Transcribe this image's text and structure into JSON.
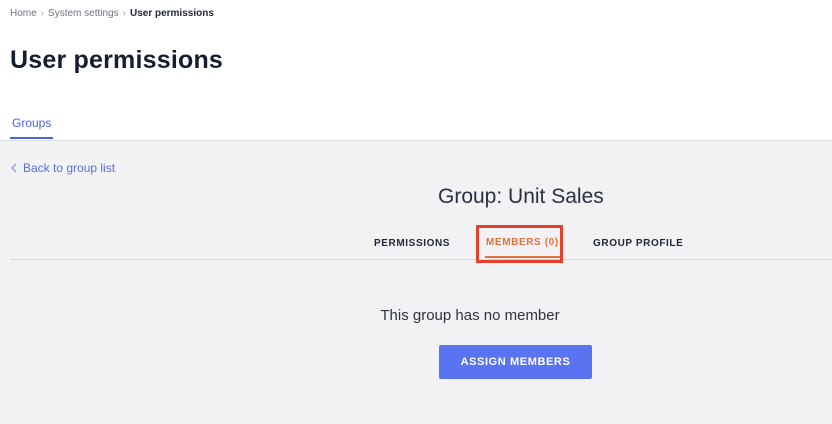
{
  "breadcrumb": {
    "items": [
      "Home",
      "System settings",
      "User permissions"
    ],
    "separator": "›"
  },
  "page": {
    "title": "User permissions"
  },
  "top_tabs": [
    {
      "label": "Groups",
      "active": true
    }
  ],
  "back_link": {
    "label": "Back to group list",
    "icon": "chevron-left-icon"
  },
  "group": {
    "title": "Group: Unit Sales"
  },
  "sub_tabs": [
    {
      "label": "PERMISSIONS",
      "active": false
    },
    {
      "label": "MEMBERS (0)",
      "active": true
    },
    {
      "label": "GROUP PROFILE",
      "active": false
    }
  ],
  "members": {
    "empty_message": "This group has no member",
    "assign_button": "ASSIGN MEMBERS"
  },
  "colors": {
    "accent": "#4a63e0",
    "active_subtab": "#e2733a",
    "highlight": "#e8412b",
    "button": "#5a73f0",
    "content_bg": "#f2f2f5"
  }
}
